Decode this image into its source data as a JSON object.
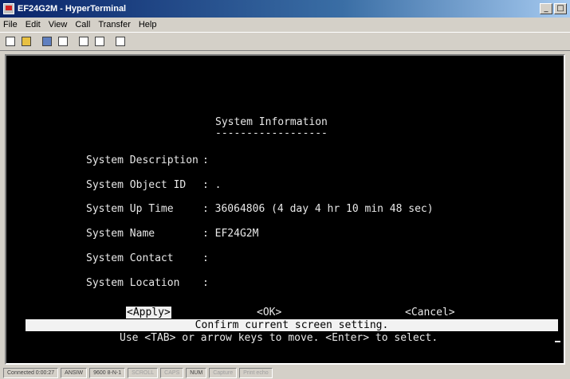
{
  "window": {
    "title": "EF24G2M - HyperTerminal",
    "minimize": "_",
    "maximize": "□"
  },
  "menu": [
    "File",
    "Edit",
    "View",
    "Call",
    "Transfer",
    "Help"
  ],
  "toolbar": [
    "new-icon",
    "open-icon",
    "connect-icon",
    "disconnect-icon",
    "send-icon",
    "receive-icon",
    "properties-icon"
  ],
  "screen": {
    "title": "System Information",
    "underline": "------------------",
    "fields": [
      {
        "label": "System Description",
        "value": ":"
      },
      {
        "label": "System Object ID",
        "value": ": ."
      },
      {
        "label": "System Up Time",
        "value": ": 36064806 (4 day 4 hr 10 min 48 sec)"
      },
      {
        "label": "System Name",
        "value": ": EF24G2M"
      },
      {
        "label": "System Contact",
        "value": ":"
      },
      {
        "label": "System Location",
        "value": ":"
      }
    ],
    "apply": "<Apply>",
    "ok": "<OK>",
    "cancel": "<Cancel>",
    "status_message": "Confirm current screen setting.",
    "hint": "Use <TAB> or arrow keys to move. <Enter> to select."
  },
  "statusbar": [
    "Connected 0:00:27",
    "ANSIW",
    "9600 8-N-1",
    "SCROLL",
    "CAPS",
    "NUM",
    "Capture",
    "Print echo"
  ]
}
